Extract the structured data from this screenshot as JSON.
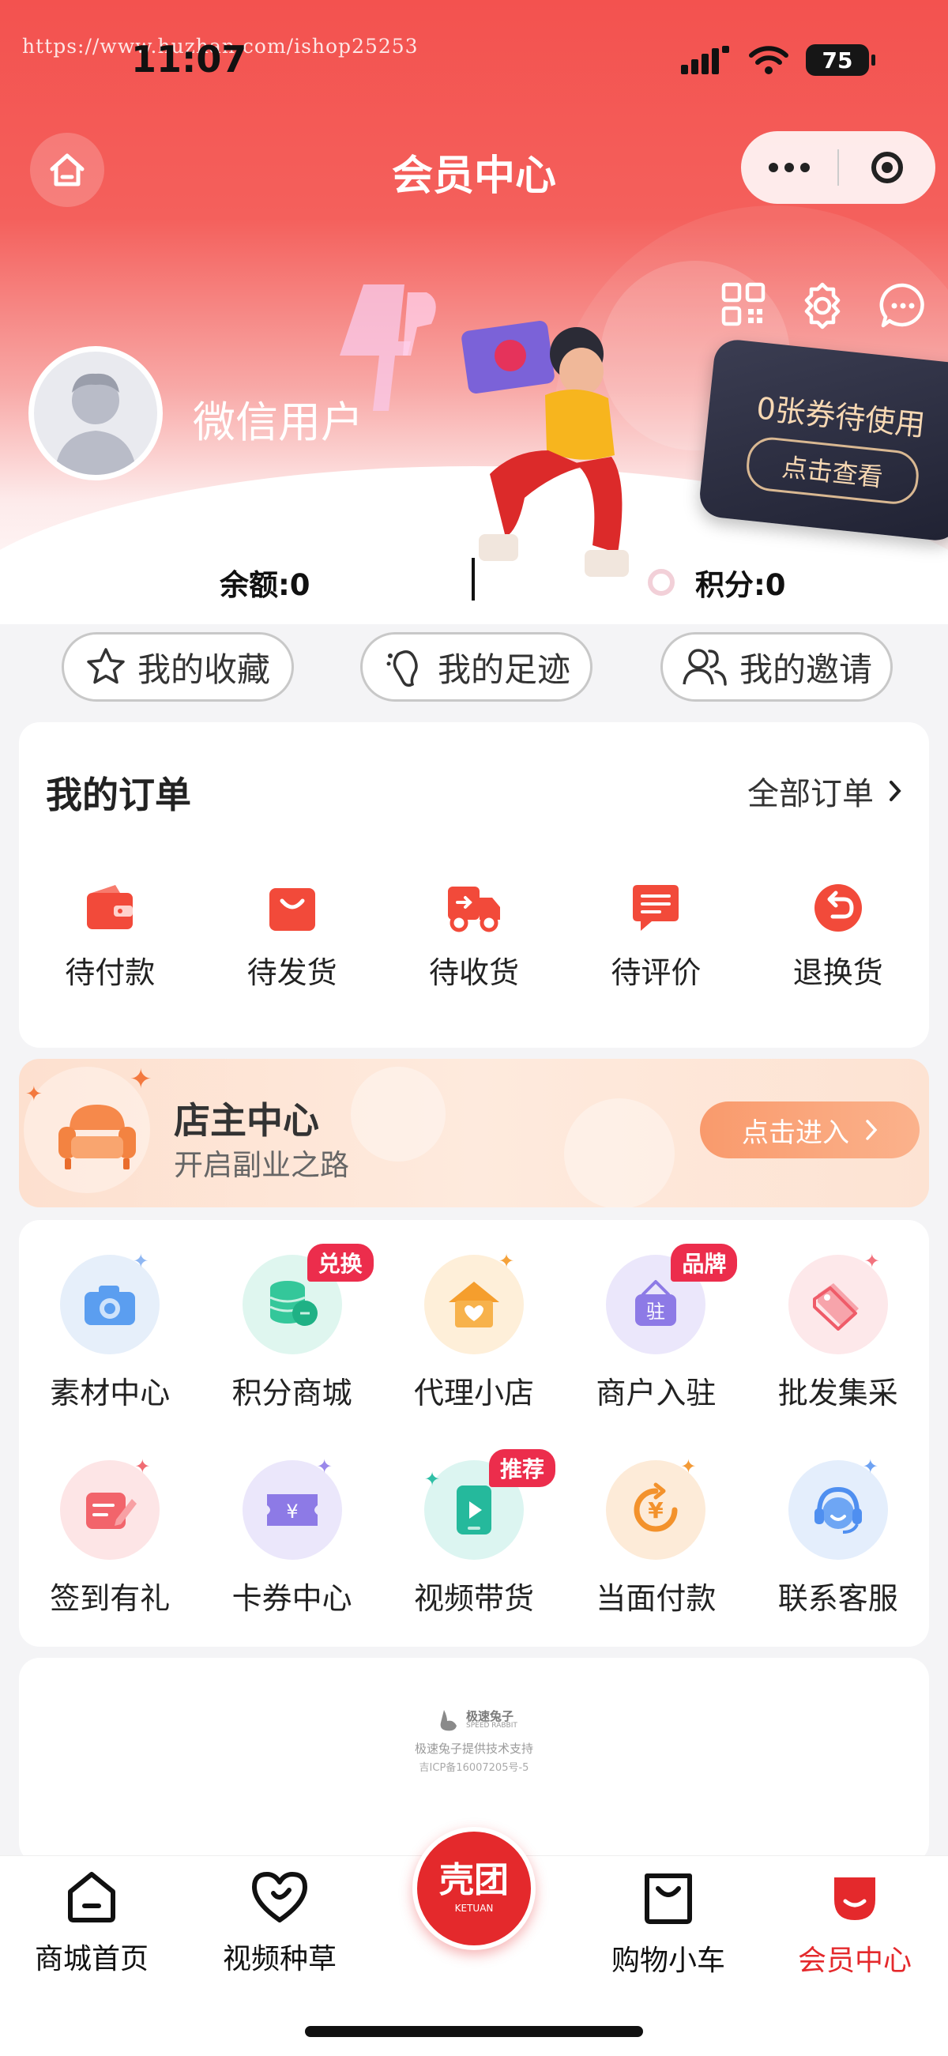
{
  "status": {
    "url": "https://www.huzhan.com/ishop25253",
    "time": "11:07",
    "battery": "75"
  },
  "header": {
    "title": "会员中心"
  },
  "profile": {
    "username": "微信用户",
    "coupon_text": "0张券待使用",
    "coupon_button": "点击查看",
    "balance": "余额:0",
    "points": "积分:0"
  },
  "quick_links": [
    {
      "label": "我的收藏",
      "icon": "star-icon"
    },
    {
      "label": "我的足迹",
      "icon": "footprint-icon"
    },
    {
      "label": "我的邀请",
      "icon": "invite-users-icon"
    }
  ],
  "orders": {
    "title": "我的订单",
    "all_label": "全部订单",
    "items": [
      {
        "label": "待付款",
        "icon": "wallet-icon"
      },
      {
        "label": "待发货",
        "icon": "bag-icon"
      },
      {
        "label": "待收货",
        "icon": "truck-icon"
      },
      {
        "label": "待评价",
        "icon": "comment-icon"
      },
      {
        "label": "退换货",
        "icon": "return-icon"
      }
    ]
  },
  "shop_owner": {
    "title": "店主中心",
    "subtitle": "开启副业之路",
    "button": "点击进入"
  },
  "services": [
    {
      "label": "素材中心",
      "icon": "camera-icon",
      "tag": ""
    },
    {
      "label": "积分商城",
      "icon": "coins-icon",
      "tag": "兑换"
    },
    {
      "label": "代理小店",
      "icon": "store-icon",
      "tag": ""
    },
    {
      "label": "商户入驻",
      "icon": "merchant-icon",
      "tag": "品牌"
    },
    {
      "label": "批发集采",
      "icon": "price-tag-icon",
      "tag": ""
    },
    {
      "label": "签到有礼",
      "icon": "signin-icon",
      "tag": ""
    },
    {
      "label": "卡券中心",
      "icon": "voucher-icon",
      "tag": ""
    },
    {
      "label": "视频带货",
      "icon": "video-icon",
      "tag": "推荐"
    },
    {
      "label": "当面付款",
      "icon": "yuan-pay-icon",
      "tag": ""
    },
    {
      "label": "联系客服",
      "icon": "customer-service-icon",
      "tag": ""
    }
  ],
  "footer": {
    "brand_name": "极速兔子",
    "brand_en": "SPEED RABBIT",
    "support": "极速兔子提供技术支持",
    "icp": "吉ICP备16007205号-5"
  },
  "tabbar": {
    "items": [
      {
        "label": "商城首页",
        "icon": "home-tab-icon"
      },
      {
        "label": "视频种草",
        "icon": "heart-tab-icon"
      },
      {
        "label": "购物小车",
        "icon": "cart-bag-tab-icon"
      },
      {
        "label": "会员中心",
        "icon": "member-tab-icon"
      }
    ],
    "center_logo": "壳团",
    "center_logo_en": "KETUAN"
  },
  "colors": {
    "brand": "#f3524f",
    "active_tab": "#e4292c",
    "order_icon": "#f24a3a",
    "tag": "#ec2d4c"
  }
}
